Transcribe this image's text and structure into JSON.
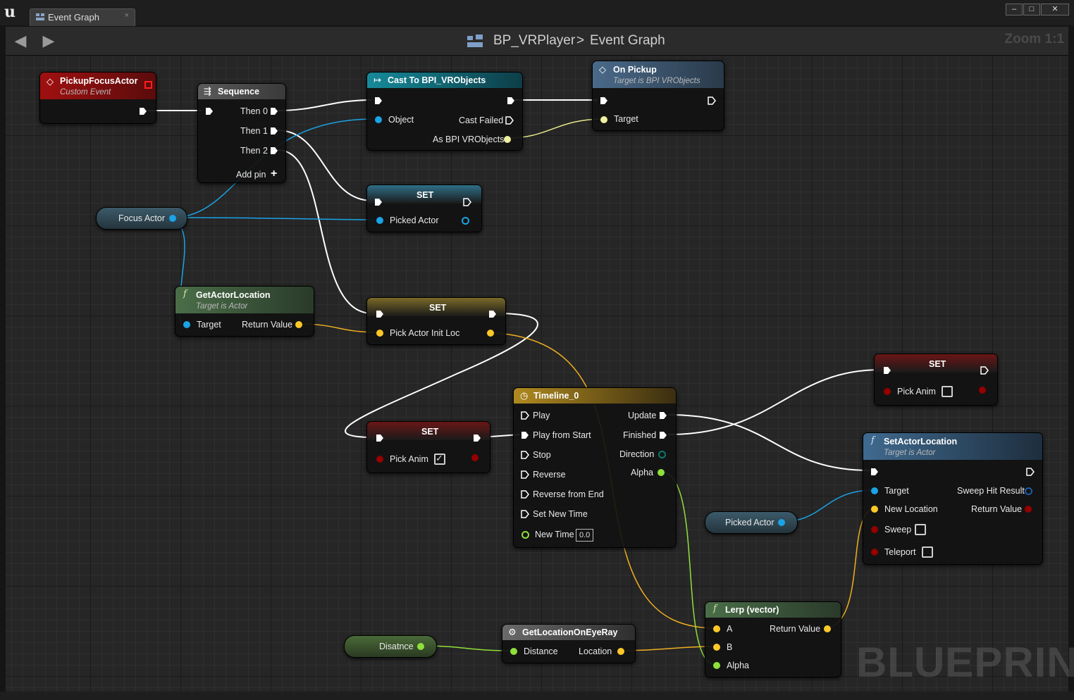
{
  "window": {
    "tab_label": "Event Graph",
    "tab_close": "×",
    "controls": {
      "minimize": "–",
      "maximize": "□",
      "close": "✕"
    }
  },
  "toolbar": {
    "breadcrumb_root": "BP_VRPlayer",
    "breadcrumb_sep": ">",
    "breadcrumb_current": "Event Graph",
    "zoom": "Zoom 1:1"
  },
  "watermark": "BLUEPRINT",
  "nodes": {
    "pickup_focus_actor": {
      "title": "PickupFocusActor",
      "subtitle": "Custom Event"
    },
    "sequence": {
      "title": "Sequence",
      "then0": "Then 0",
      "then1": "Then 1",
      "then2": "Then 2",
      "add_pin": "Add pin"
    },
    "cast": {
      "title": "Cast To BPI_VRObjects",
      "object": "Object",
      "cast_failed": "Cast Failed",
      "as_obj": "As BPI VRObjects"
    },
    "on_pickup": {
      "title": "On Pickup",
      "subtitle": "Target is BPI VRObjects",
      "target": "Target"
    },
    "set_picked_actor": {
      "title": "SET",
      "pin": "Picked Actor"
    },
    "focus_actor": {
      "label": "Focus Actor"
    },
    "get_actor_location": {
      "title": "GetActorLocation",
      "subtitle": "Target is Actor",
      "target": "Target",
      "return_value": "Return Value"
    },
    "set_pick_actor_init_loc": {
      "title": "SET",
      "pin": "Pick Actor Init Loc"
    },
    "set_pick_anim_true": {
      "title": "SET",
      "pin": "Pick Anim",
      "checked": true
    },
    "timeline": {
      "title": "Timeline_0",
      "inputs": [
        "Play",
        "Play from Start",
        "Stop",
        "Reverse",
        "Reverse from End",
        "Set New Time"
      ],
      "new_time_label": "New Time",
      "new_time_value": "0.0",
      "update": "Update",
      "finished": "Finished",
      "direction": "Direction",
      "alpha": "Alpha"
    },
    "set_pick_anim_false": {
      "title": "SET",
      "pin": "Pick Anim",
      "checked": false
    },
    "set_actor_location": {
      "title": "SetActorLocation",
      "subtitle": "Target is Actor",
      "target": "Target",
      "new_location": "New Location",
      "sweep": "Sweep",
      "teleport": "Teleport",
      "sweep_hit_result": "Sweep Hit Result",
      "return_value": "Return Value"
    },
    "picked_actor": {
      "label": "Picked Actor"
    },
    "lerp": {
      "title": "Lerp (vector)",
      "a": "A",
      "b": "B",
      "alpha": "Alpha",
      "return_value": "Return Value"
    },
    "get_location_on_eye_ray": {
      "title": "GetLocationOnEyeRay",
      "distance": "Distance",
      "location": "Location"
    },
    "disatnce": {
      "label": "Disatnce"
    }
  },
  "colors": {
    "exec": "#ffffff",
    "object": "#00a8f0",
    "vector": "#fdc828",
    "float": "#9cf043",
    "bool": "#950000",
    "event_header": "#8b0000",
    "function_header": "#3b5c3a",
    "cast_header": "#125a6a",
    "timeline_header": "#8a6a1a"
  }
}
